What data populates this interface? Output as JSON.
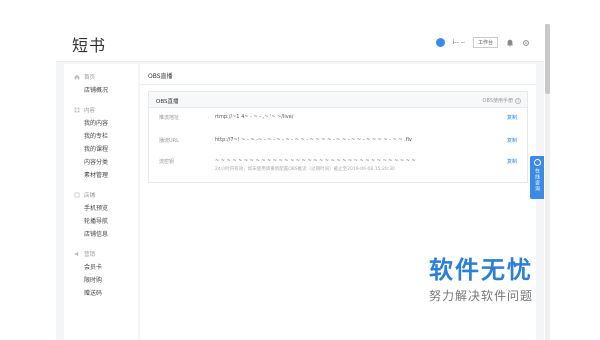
{
  "app": {
    "logo": "短书"
  },
  "header": {
    "user_name": "i-- --",
    "shop_switch": "工作台"
  },
  "sidebar": {
    "groups": [
      {
        "label": "首页",
        "icon": "home-icon",
        "items": [
          "店铺概况"
        ]
      },
      {
        "label": "内容",
        "icon": "grid-icon",
        "items": [
          "我的内容",
          "我的专栏",
          "我的课程",
          "内容分类",
          "素材管理"
        ]
      },
      {
        "label": "店铺",
        "icon": "shop-icon",
        "items": [
          "手机预览",
          "轮播导航",
          "店铺信息"
        ]
      },
      {
        "label": "营销",
        "icon": "megaphone-icon",
        "items": [
          "会员卡",
          "限时购",
          "赠送码"
        ]
      }
    ]
  },
  "main": {
    "title": "OBS直播",
    "card": {
      "title": "OBS直播",
      "help": "OBS使用手册",
      "rows": [
        {
          "label": "推流地址",
          "value": "rtmp://~1 4~ - ~ - ,~ '~ ~/live/",
          "copy": "复制"
        },
        {
          "label": "播流URL",
          "value": "http://7~! ~ - ~ -~ - ~ - ~ - ~ - ~ ~ - ~ ~ ~ ~ - ~ ~ - ~ ~ - ~ ~ ~ ~ - ~ ~ .flv",
          "copy": "复制"
        },
        {
          "label": "流密钥",
          "value": "~ ~ ~ ~ ~ ~ ~ ~ ~ ~ ~ ~ ~ ~ ~ ~ ~ ~ ~ ~ ~ ~ ~ ~ ~ ~ ~ ~ ~ ~ ~ ~ ~ ~ ~",
          "note": "24小时内有效，如未使用请重新配置OBS推流（过期时间）截止至2019-06-08 15:20:30",
          "copy": "复制"
        }
      ]
    }
  },
  "float_service": {
    "label": "在线咨询"
  },
  "watermark": {
    "main": "软件无忧",
    "sub": "努力解决软件问题"
  },
  "colors": {
    "accent": "#3b8be6",
    "link": "#2d86e6",
    "watermark": "#2a7fd6"
  }
}
